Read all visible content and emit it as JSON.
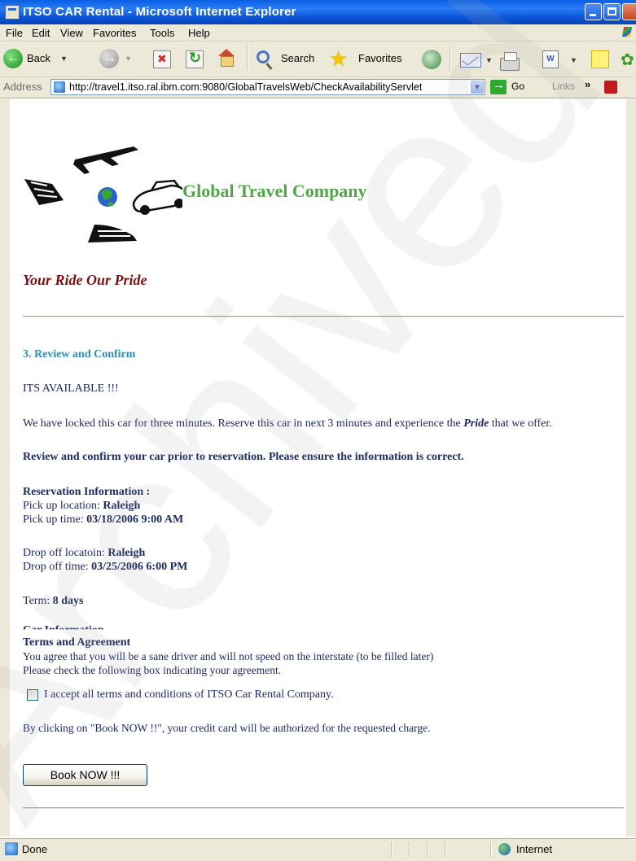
{
  "window": {
    "title": "ITSO CAR Rental - Microsoft Internet Explorer"
  },
  "menu": [
    "File",
    "Edit",
    "View",
    "Favorites",
    "Tools",
    "Help"
  ],
  "toolbar": {
    "back": "Back",
    "search": "Search",
    "favorites": "Favorites"
  },
  "address": {
    "label": "Address",
    "url": "http://travel1.itso.ral.ibm.com:9080/GlobalTravelsWeb/CheckAvailabilityServlet",
    "go": "Go",
    "links": "Links",
    "more": "»"
  },
  "page": {
    "brand": "Global Travel Company",
    "tagline": "Your Ride Our Pride",
    "step": "3. Review and Confirm",
    "available": "ITS AVAILABLE !!!",
    "locked_pre": "We have locked this car for three minutes. Reserve this car in next 3 minutes and experience the ",
    "locked_em": "Pride",
    "locked_post": " that we offer.",
    "review": "Review and confirm your car prior to reservation. Please ensure the information is correct.",
    "reservation_heading": "Reservation Information :",
    "pickup_location_label": "Pick up location: ",
    "pickup_location": "Raleigh",
    "pickup_time_label": "Pick up time: ",
    "pickup_time": "03/18/2006 9:00 AM",
    "dropoff_location_label": "Drop off locatoin: ",
    "dropoff_location": "Raleigh",
    "dropoff_time_label": "Drop off time: ",
    "dropoff_time": "03/25/2006 6:00 PM",
    "term_label": "Term: ",
    "term": "8 days",
    "car_info_partial": "Car Information",
    "terms_heading": "Terms and Agreement",
    "terms_line1": "You agree that you will be a sane driver and will not speed on the interstate (to be filled later)",
    "terms_line2": "Please check the following box indicating your agreement.",
    "accept_label": "I accept all terms and conditions of ITSO Car Rental Company.",
    "authorize_note": "By clicking on \"Book NOW !!\", your credit card will be authorized for the requested charge.",
    "book_button": "Book NOW !!!"
  },
  "status": {
    "text": "Done",
    "zone": "Internet"
  },
  "watermark": "Archived",
  "colors": {
    "brand": "#4fa845",
    "tagline": "#7a1010",
    "step": "#2b8fb7",
    "body_text": "#1d2a63",
    "titlebar": "#0a55d8"
  },
  "icons": [
    "back-arrow-icon",
    "forward-arrow-icon",
    "stop-icon",
    "refresh-icon",
    "home-icon",
    "search-icon",
    "favorites-star-icon",
    "media-icon",
    "mail-icon",
    "print-icon",
    "word-icon",
    "note-icon",
    "messenger-icon",
    "page-icon",
    "go-arrow-icon",
    "pdf-icon",
    "internet-zone-icon"
  ]
}
